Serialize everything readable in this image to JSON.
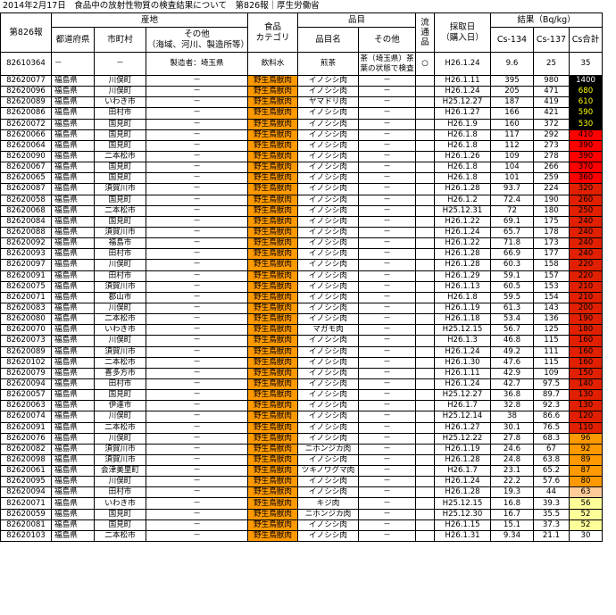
{
  "title": "2014年2月17日　食品中の放射性物質の検査結果について　第826報｜厚生労働省",
  "header": {
    "report_no": "第826報",
    "origin": "産地",
    "prefecture": "都道府県",
    "municipality": "市町村",
    "origin_other": "その他\n（海域、河川、製造所等）",
    "category": "食品\nカテゴリ",
    "item": "品目",
    "item_name": "品目名",
    "item_other": "その他",
    "distributed": "流通品",
    "sample_date": "採取日\n（購入日）",
    "results": "結果（Bq/kg）",
    "cs134": "Cs-134",
    "cs137": "Cs-137",
    "cs_total": "Cs合計"
  },
  "colors": {
    "wild_meat_category": "#ff9900",
    "result_1400": "#000000",
    "result_680_530": "#000000",
    "result_410_360": "#ff0000",
    "result_350_110": "#cc2200",
    "result_96_80": "#ff9900",
    "result_63": "#ffcc99",
    "result_56_52": "#ffff99",
    "result_30": "#ffffff"
  },
  "rows": [
    {
      "id": "82610364",
      "pref": "－",
      "muni": "－",
      "other": "製造者：埼玉県",
      "cat": "飲料水",
      "item": "煎茶",
      "item_other": "茶（埼玉県）茶葉の状態で検査",
      "dist": "○",
      "date": "H26.1.24",
      "cs134": "9.6",
      "cs137": "25",
      "total": "35",
      "bg": "#ffffff",
      "fg": "#000000"
    },
    {
      "id": "82620077",
      "pref": "福島県",
      "muni": "川俣町",
      "other": "－",
      "cat": "野生鳥獣肉",
      "item": "イノシシ肉",
      "item_other": "－",
      "dist": "",
      "date": "H26.1.11",
      "cs134": "395",
      "cs137": "980",
      "total": "1400",
      "bg": "#000000",
      "fg": "#ffffff"
    },
    {
      "id": "82620096",
      "pref": "福島県",
      "muni": "川俣町",
      "other": "－",
      "cat": "野生鳥獣肉",
      "item": "イノシシ肉",
      "item_other": "－",
      "dist": "",
      "date": "H26.1.24",
      "cs134": "205",
      "cs137": "471",
      "total": "680",
      "bg": "#000000",
      "fg": "#ffff00"
    },
    {
      "id": "82620089",
      "pref": "福島県",
      "muni": "いわき市",
      "other": "－",
      "cat": "野生鳥獣肉",
      "item": "ヤマドリ肉",
      "item_other": "－",
      "dist": "",
      "date": "H25.12.27",
      "cs134": "187",
      "cs137": "419",
      "total": "610",
      "bg": "#000000",
      "fg": "#ffff00"
    },
    {
      "id": "82620086",
      "pref": "福島県",
      "muni": "田村市",
      "other": "－",
      "cat": "野生鳥獣肉",
      "item": "イノシシ肉",
      "item_other": "－",
      "dist": "",
      "date": "H26.1.27",
      "cs134": "166",
      "cs137": "421",
      "total": "590",
      "bg": "#000000",
      "fg": "#ffff00"
    },
    {
      "id": "82620072",
      "pref": "福島県",
      "muni": "国見町",
      "other": "－",
      "cat": "野生鳥獣肉",
      "item": "イノシシ肉",
      "item_other": "－",
      "dist": "",
      "date": "H26.1.9",
      "cs134": "160",
      "cs137": "372",
      "total": "530",
      "bg": "#000000",
      "fg": "#ffff00"
    },
    {
      "id": "82620066",
      "pref": "福島県",
      "muni": "国見町",
      "other": "－",
      "cat": "野生鳥獣肉",
      "item": "イノシシ肉",
      "item_other": "－",
      "dist": "",
      "date": "H26.1.8",
      "cs134": "117",
      "cs137": "292",
      "total": "410",
      "bg": "#ff0000",
      "fg": "#000000"
    },
    {
      "id": "82620064",
      "pref": "福島県",
      "muni": "国見町",
      "other": "－",
      "cat": "野生鳥獣肉",
      "item": "イノシシ肉",
      "item_other": "－",
      "dist": "",
      "date": "H26.1.8",
      "cs134": "112",
      "cs137": "273",
      "total": "390",
      "bg": "#ff0000",
      "fg": "#000000"
    },
    {
      "id": "82620090",
      "pref": "福島県",
      "muni": "二本松市",
      "other": "－",
      "cat": "野生鳥獣肉",
      "item": "イノシシ肉",
      "item_other": "－",
      "dist": "",
      "date": "H26.1.26",
      "cs134": "109",
      "cs137": "278",
      "total": "390",
      "bg": "#ff0000",
      "fg": "#000000"
    },
    {
      "id": "82620067",
      "pref": "福島県",
      "muni": "国見町",
      "other": "－",
      "cat": "野生鳥獣肉",
      "item": "イノシシ肉",
      "item_other": "－",
      "dist": "",
      "date": "H26.1.8",
      "cs134": "104",
      "cs137": "266",
      "total": "370",
      "bg": "#ff0000",
      "fg": "#000000"
    },
    {
      "id": "82620065",
      "pref": "福島県",
      "muni": "国見町",
      "other": "－",
      "cat": "野生鳥獣肉",
      "item": "イノシシ肉",
      "item_other": "－",
      "dist": "",
      "date": "H26.1.8",
      "cs134": "101",
      "cs137": "259",
      "total": "360",
      "bg": "#ff0000",
      "fg": "#000000"
    },
    {
      "id": "82620087",
      "pref": "福島県",
      "muni": "須賀川市",
      "other": "－",
      "cat": "野生鳥獣肉",
      "item": "イノシシ肉",
      "item_other": "－",
      "dist": "",
      "date": "H26.1.28",
      "cs134": "93.7",
      "cs137": "224",
      "total": "320",
      "bg": "#e02000",
      "fg": "#000000"
    },
    {
      "id": "82620058",
      "pref": "福島県",
      "muni": "国見町",
      "other": "－",
      "cat": "野生鳥獣肉",
      "item": "イノシシ肉",
      "item_other": "－",
      "dist": "",
      "date": "H26.1.2",
      "cs134": "72.4",
      "cs137": "190",
      "total": "260",
      "bg": "#e02000",
      "fg": "#000000"
    },
    {
      "id": "82620068",
      "pref": "福島県",
      "muni": "二本松市",
      "other": "－",
      "cat": "野生鳥獣肉",
      "item": "イノシシ肉",
      "item_other": "－",
      "dist": "",
      "date": "H25.12.31",
      "cs134": "72",
      "cs137": "180",
      "total": "250",
      "bg": "#e02000",
      "fg": "#000000"
    },
    {
      "id": "82620084",
      "pref": "福島県",
      "muni": "国見町",
      "other": "－",
      "cat": "野生鳥獣肉",
      "item": "イノシシ肉",
      "item_other": "－",
      "dist": "",
      "date": "H26.1.22",
      "cs134": "69.1",
      "cs137": "175",
      "total": "240",
      "bg": "#e02000",
      "fg": "#000000"
    },
    {
      "id": "82620088",
      "pref": "福島県",
      "muni": "須賀川市",
      "other": "－",
      "cat": "野生鳥獣肉",
      "item": "イノシシ肉",
      "item_other": "－",
      "dist": "",
      "date": "H26.1.24",
      "cs134": "65.7",
      "cs137": "178",
      "total": "240",
      "bg": "#e02000",
      "fg": "#000000"
    },
    {
      "id": "82620092",
      "pref": "福島県",
      "muni": "福島市",
      "other": "－",
      "cat": "野生鳥獣肉",
      "item": "イノシシ肉",
      "item_other": "－",
      "dist": "",
      "date": "H26.1.22",
      "cs134": "71.8",
      "cs137": "173",
      "total": "240",
      "bg": "#e02000",
      "fg": "#000000"
    },
    {
      "id": "82620093",
      "pref": "福島県",
      "muni": "田村市",
      "other": "－",
      "cat": "野生鳥獣肉",
      "item": "イノシシ肉",
      "item_other": "－",
      "dist": "",
      "date": "H26.1.28",
      "cs134": "66.9",
      "cs137": "177",
      "total": "240",
      "bg": "#e02000",
      "fg": "#000000"
    },
    {
      "id": "82620097",
      "pref": "福島県",
      "muni": "川俣町",
      "other": "－",
      "cat": "野生鳥獣肉",
      "item": "イノシシ肉",
      "item_other": "－",
      "dist": "",
      "date": "H26.1.28",
      "cs134": "60.3",
      "cs137": "158",
      "total": "220",
      "bg": "#e02000",
      "fg": "#000000"
    },
    {
      "id": "82620091",
      "pref": "福島県",
      "muni": "田村市",
      "other": "－",
      "cat": "野生鳥獣肉",
      "item": "イノシシ肉",
      "item_other": "－",
      "dist": "",
      "date": "H26.1.29",
      "cs134": "59.1",
      "cs137": "157",
      "total": "220",
      "bg": "#e02000",
      "fg": "#000000"
    },
    {
      "id": "82620075",
      "pref": "福島県",
      "muni": "須賀川市",
      "other": "－",
      "cat": "野生鳥獣肉",
      "item": "イノシシ肉",
      "item_other": "－",
      "dist": "",
      "date": "H26.1.13",
      "cs134": "60.5",
      "cs137": "153",
      "total": "210",
      "bg": "#e02000",
      "fg": "#000000"
    },
    {
      "id": "82620071",
      "pref": "福島県",
      "muni": "郡山市",
      "other": "－",
      "cat": "野生鳥獣肉",
      "item": "イノシシ肉",
      "item_other": "－",
      "dist": "",
      "date": "H26.1.8",
      "cs134": "59.5",
      "cs137": "154",
      "total": "210",
      "bg": "#e02000",
      "fg": "#000000"
    },
    {
      "id": "82620083",
      "pref": "福島県",
      "muni": "川俣町",
      "other": "－",
      "cat": "野生鳥獣肉",
      "item": "イノシシ肉",
      "item_other": "－",
      "dist": "",
      "date": "H26.1.19",
      "cs134": "61.3",
      "cs137": "143",
      "total": "200",
      "bg": "#e02000",
      "fg": "#000000"
    },
    {
      "id": "82620080",
      "pref": "福島県",
      "muni": "二本松市",
      "other": "－",
      "cat": "野生鳥獣肉",
      "item": "イノシシ肉",
      "item_other": "－",
      "dist": "",
      "date": "H26.1.18",
      "cs134": "53.4",
      "cs137": "136",
      "total": "190",
      "bg": "#e02000",
      "fg": "#000000"
    },
    {
      "id": "82620070",
      "pref": "福島県",
      "muni": "いわき市",
      "other": "－",
      "cat": "野生鳥獣肉",
      "item": "マガモ肉",
      "item_other": "－",
      "dist": "",
      "date": "H25.12.15",
      "cs134": "56.7",
      "cs137": "125",
      "total": "180",
      "bg": "#e02000",
      "fg": "#000000"
    },
    {
      "id": "82620073",
      "pref": "福島県",
      "muni": "川俣町",
      "other": "－",
      "cat": "野生鳥獣肉",
      "item": "イノシシ肉",
      "item_other": "－",
      "dist": "",
      "date": "H26.1.3",
      "cs134": "46.8",
      "cs137": "115",
      "total": "160",
      "bg": "#e02000",
      "fg": "#000000"
    },
    {
      "id": "82620089",
      "pref": "福島県",
      "muni": "須賀川市",
      "other": "－",
      "cat": "野生鳥獣肉",
      "item": "イノシシ肉",
      "item_other": "－",
      "dist": "",
      "date": "H26.1.24",
      "cs134": "49.2",
      "cs137": "111",
      "total": "160",
      "bg": "#e02000",
      "fg": "#000000"
    },
    {
      "id": "82620102",
      "pref": "福島県",
      "muni": "二本松市",
      "other": "－",
      "cat": "野生鳥獣肉",
      "item": "イノシシ肉",
      "item_other": "－",
      "dist": "",
      "date": "H26.1.30",
      "cs134": "47.6",
      "cs137": "115",
      "total": "160",
      "bg": "#e02000",
      "fg": "#000000"
    },
    {
      "id": "82620079",
      "pref": "福島県",
      "muni": "喜多方市",
      "other": "－",
      "cat": "野生鳥獣肉",
      "item": "イノシシ肉",
      "item_other": "－",
      "dist": "",
      "date": "H26.1.11",
      "cs134": "42.9",
      "cs137": "109",
      "total": "150",
      "bg": "#e02000",
      "fg": "#000000"
    },
    {
      "id": "82620094",
      "pref": "福島県",
      "muni": "田村市",
      "other": "－",
      "cat": "野生鳥獣肉",
      "item": "イノシシ肉",
      "item_other": "－",
      "dist": "",
      "date": "H26.1.24",
      "cs134": "42.7",
      "cs137": "97.5",
      "total": "140",
      "bg": "#e02000",
      "fg": "#000000"
    },
    {
      "id": "82620057",
      "pref": "福島県",
      "muni": "国見町",
      "other": "－",
      "cat": "野生鳥獣肉",
      "item": "イノシシ肉",
      "item_other": "－",
      "dist": "",
      "date": "H25.12.27",
      "cs134": "36.8",
      "cs137": "89.7",
      "total": "130",
      "bg": "#e02000",
      "fg": "#000000"
    },
    {
      "id": "82620063",
      "pref": "福島県",
      "muni": "伊達市",
      "other": "－",
      "cat": "野生鳥獣肉",
      "item": "イノシシ肉",
      "item_other": "－",
      "dist": "",
      "date": "H26.1.7",
      "cs134": "32.8",
      "cs137": "92.3",
      "total": "130",
      "bg": "#e02000",
      "fg": "#000000"
    },
    {
      "id": "82620074",
      "pref": "福島県",
      "muni": "川俣町",
      "other": "－",
      "cat": "野生鳥獣肉",
      "item": "イノシシ肉",
      "item_other": "－",
      "dist": "",
      "date": "H25.12.14",
      "cs134": "38",
      "cs137": "86.6",
      "total": "120",
      "bg": "#e02000",
      "fg": "#000000"
    },
    {
      "id": "82620091",
      "pref": "福島県",
      "muni": "二本松市",
      "other": "－",
      "cat": "野生鳥獣肉",
      "item": "イノシシ肉",
      "item_other": "－",
      "dist": "",
      "date": "H26.1.27",
      "cs134": "30.1",
      "cs137": "76.5",
      "total": "110",
      "bg": "#e02000",
      "fg": "#000000"
    },
    {
      "id": "82620076",
      "pref": "福島県",
      "muni": "川俣町",
      "other": "－",
      "cat": "野生鳥獣肉",
      "item": "イノシシ肉",
      "item_other": "－",
      "dist": "",
      "date": "H25.12.22",
      "cs134": "27.8",
      "cs137": "68.3",
      "total": "96",
      "bg": "#ff9900",
      "fg": "#000000"
    },
    {
      "id": "82620082",
      "pref": "福島県",
      "muni": "須賀川市",
      "other": "－",
      "cat": "野生鳥獣肉",
      "item": "ニホンジカ肉",
      "item_other": "－",
      "dist": "",
      "date": "H26.1.19",
      "cs134": "24.6",
      "cs137": "67",
      "total": "92",
      "bg": "#ff9900",
      "fg": "#000000"
    },
    {
      "id": "82620098",
      "pref": "福島県",
      "muni": "須賀川市",
      "other": "－",
      "cat": "野生鳥獣肉",
      "item": "イノシシ肉",
      "item_other": "－",
      "dist": "",
      "date": "H26.1.28",
      "cs134": "24.8",
      "cs137": "63.8",
      "total": "89",
      "bg": "#ff9900",
      "fg": "#000000"
    },
    {
      "id": "82620061",
      "pref": "福島県",
      "muni": "会津美里町",
      "other": "－",
      "cat": "野生鳥獣肉",
      "item": "ツキノワグマ肉",
      "item_other": "－",
      "dist": "",
      "date": "H26.1.7",
      "cs134": "23.1",
      "cs137": "65.2",
      "total": "87",
      "bg": "#ff9900",
      "fg": "#000000"
    },
    {
      "id": "82620095",
      "pref": "福島県",
      "muni": "川俣町",
      "other": "－",
      "cat": "野生鳥獣肉",
      "item": "イノシシ肉",
      "item_other": "－",
      "dist": "",
      "date": "H26.1.24",
      "cs134": "22.2",
      "cs137": "57.6",
      "total": "80",
      "bg": "#ff9900",
      "fg": "#000000"
    },
    {
      "id": "82620094",
      "pref": "福島県",
      "muni": "田村市",
      "other": "－",
      "cat": "野生鳥獣肉",
      "item": "イノシシ肉",
      "item_other": "－",
      "dist": "",
      "date": "H26.1.28",
      "cs134": "19.3",
      "cs137": "44",
      "total": "63",
      "bg": "#ffcc99",
      "fg": "#000000"
    },
    {
      "id": "82620071",
      "pref": "福島県",
      "muni": "いわき市",
      "other": "－",
      "cat": "野生鳥獣肉",
      "item": "キジ肉",
      "item_other": "－",
      "dist": "",
      "date": "H25.12.15",
      "cs134": "16.8",
      "cs137": "39.3",
      "total": "56",
      "bg": "#ffff99",
      "fg": "#000000"
    },
    {
      "id": "82620059",
      "pref": "福島県",
      "muni": "国見町",
      "other": "－",
      "cat": "野生鳥獣肉",
      "item": "ニホンジカ肉",
      "item_other": "－",
      "dist": "",
      "date": "H25.12.30",
      "cs134": "16.7",
      "cs137": "35.5",
      "total": "52",
      "bg": "#ffff99",
      "fg": "#000000"
    },
    {
      "id": "82620081",
      "pref": "福島県",
      "muni": "国見町",
      "other": "－",
      "cat": "野生鳥獣肉",
      "item": "イノシシ肉",
      "item_other": "－",
      "dist": "",
      "date": "H26.1.15",
      "cs134": "15.1",
      "cs137": "37.3",
      "total": "52",
      "bg": "#ffff99",
      "fg": "#000000"
    },
    {
      "id": "82620103",
      "pref": "福島県",
      "muni": "二本松市",
      "other": "－",
      "cat": "野生鳥獣肉",
      "item": "イノシシ肉",
      "item_other": "－",
      "dist": "",
      "date": "H26.1.31",
      "cs134": "9.34",
      "cs137": "21.1",
      "total": "30",
      "bg": "#ffffff",
      "fg": "#000000"
    }
  ]
}
